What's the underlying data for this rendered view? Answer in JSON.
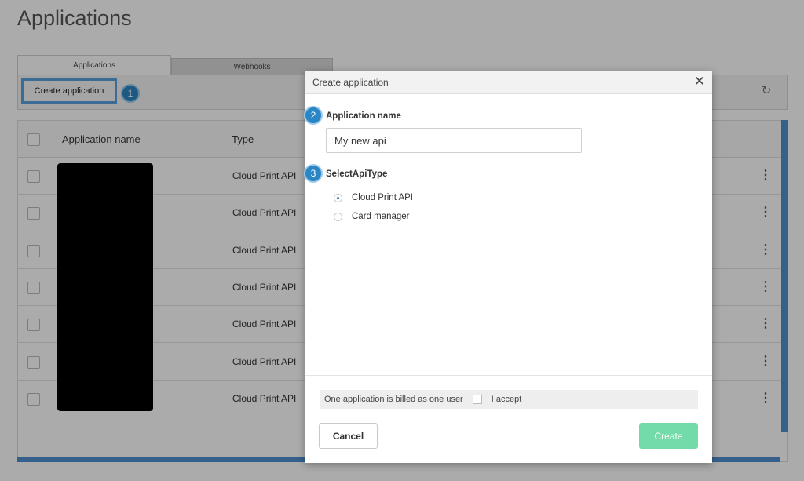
{
  "page": {
    "title": "Applications",
    "tabs": [
      {
        "label": "Applications",
        "active": true
      },
      {
        "label": "Webhooks",
        "active": false
      }
    ],
    "toolbar": {
      "create_label": "Create application",
      "reload_icon": "reload-icon"
    },
    "steps": [
      "1",
      "2",
      "3"
    ],
    "grid": {
      "columns": [
        "Application name",
        "Type"
      ],
      "rows": [
        {
          "type": "Cloud Print API"
        },
        {
          "type": "Cloud Print API"
        },
        {
          "type": "Cloud Print API"
        },
        {
          "type": "Cloud Print API"
        },
        {
          "type": "Cloud Print API"
        },
        {
          "type": "Cloud Print API"
        },
        {
          "type": "Cloud Print API"
        }
      ],
      "row_menu_glyph": "⋮"
    }
  },
  "modal": {
    "title": "Create application",
    "close_glyph": "✕",
    "name_label": "Application name",
    "name_value": "My new api",
    "api_type_label": "SelectApiType",
    "api_options": [
      {
        "label": "Cloud Print API",
        "selected": true
      },
      {
        "label": "Card manager",
        "selected": false
      }
    ],
    "billing_text": "One application is billed as one user",
    "accept_label": "I accept",
    "cancel_label": "Cancel",
    "create_label": "Create"
  },
  "colors": {
    "accent": "#2b86c5",
    "create_button": "#72dba9",
    "highlight": "#5aa0e0"
  }
}
